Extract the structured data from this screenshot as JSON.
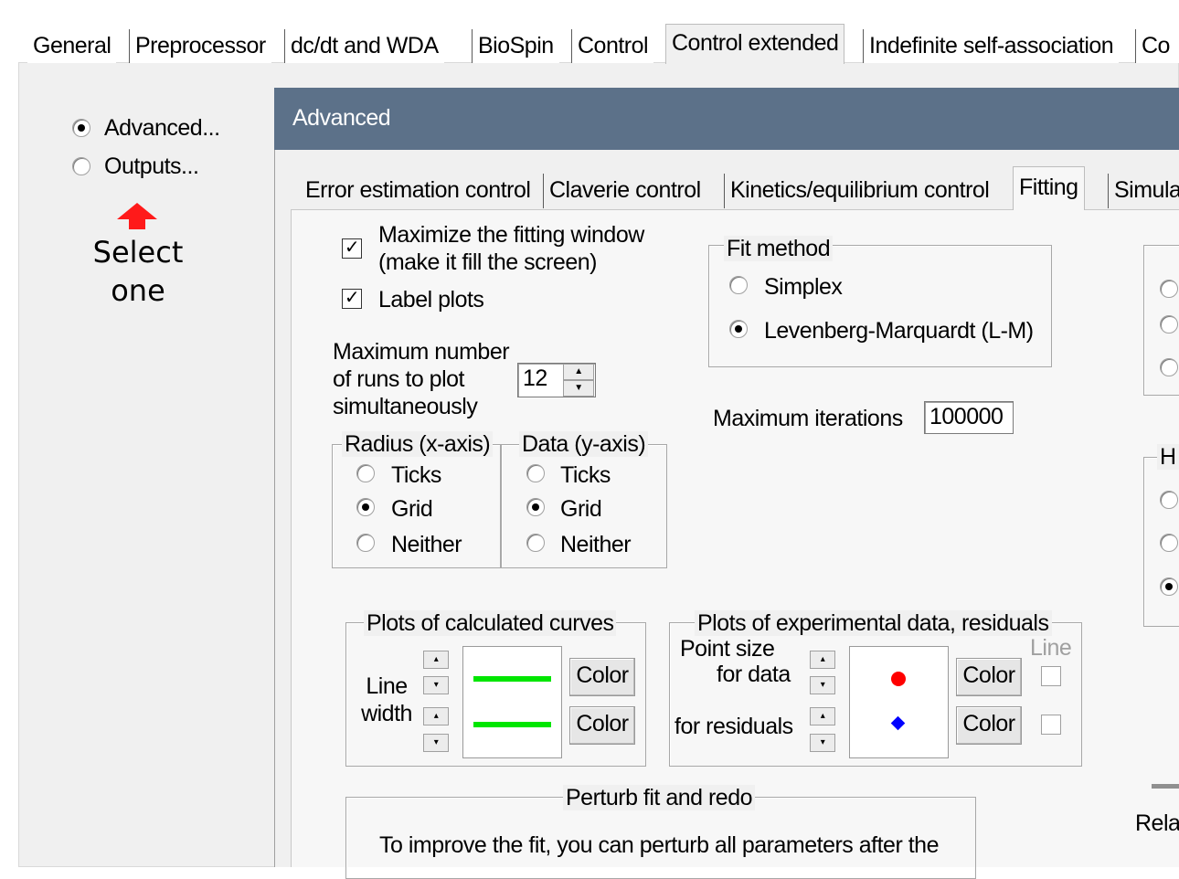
{
  "top_tabs": [
    {
      "label": "General"
    },
    {
      "label": "Preprocessor"
    },
    {
      "label": "dc/dt and WDA"
    },
    {
      "label": "BioSpin"
    },
    {
      "label": "Control"
    },
    {
      "label": "Control extended",
      "active": true
    },
    {
      "label": "Indefinite self-association"
    },
    {
      "label": "Co"
    }
  ],
  "left": {
    "options": [
      {
        "label": "Advanced...",
        "selected": true
      },
      {
        "label": "Outputs...",
        "selected": false
      }
    ],
    "hint_line1": "Select",
    "hint_line2": "one"
  },
  "advanced": {
    "title": "Advanced",
    "tabs": [
      {
        "label": "Error estimation control"
      },
      {
        "label": "Claverie control"
      },
      {
        "label": "Kinetics/equilibrium control"
      },
      {
        "label": "Fitting",
        "active": true
      },
      {
        "label": "Simula"
      }
    ]
  },
  "fitting": {
    "maximize_line1": "Maximize the fitting window",
    "maximize_line2": "(make it fill the screen)",
    "maximize_checked": true,
    "label_plots": "Label plots",
    "label_plots_checked": true,
    "max_runs_line1": "Maximum number",
    "max_runs_line2": "of runs to plot",
    "max_runs_line3": "simultaneously",
    "max_runs_value": "12",
    "radius_group": {
      "title": "Radius (x-axis)",
      "options": [
        "Ticks",
        "Grid",
        "Neither"
      ],
      "selected": "Grid"
    },
    "data_group": {
      "title": "Data (y-axis)",
      "options": [
        "Ticks",
        "Grid",
        "Neither"
      ],
      "selected": "Grid"
    },
    "fit_method": {
      "title": "Fit method",
      "options": [
        "Simplex",
        "Levenberg-Marquardt (L-M)"
      ],
      "selected": "Levenberg-Marquardt (L-M)"
    },
    "max_iterations_label": "Maximum iterations",
    "max_iterations_value": "100000",
    "right_group_title": "H",
    "right_bottom_text": "Rela",
    "calc_curves": {
      "title": "Plots of calculated curves",
      "line_label1": "Line",
      "line_label2": "width",
      "color_label": "Color",
      "line_color": "#00e600"
    },
    "exp_data": {
      "title": "Plots of experimental data, residuals",
      "point_size_line1": "Point size",
      "point_size_line2": "for data",
      "for_residuals": "for residuals",
      "line_header": "Line",
      "color_label": "Color",
      "data_color": "#ff0000",
      "residual_color": "#0000ff"
    },
    "perturb": {
      "title": "Perturb fit and redo",
      "text": "To improve the fit, you can perturb all parameters after the"
    }
  }
}
